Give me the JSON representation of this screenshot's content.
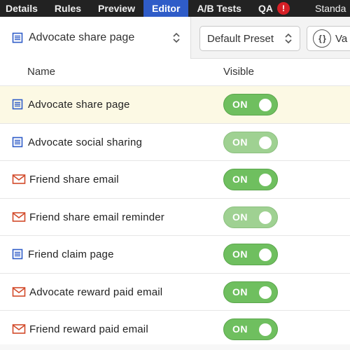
{
  "nav": {
    "tabs": [
      {
        "label": "Details"
      },
      {
        "label": "Rules"
      },
      {
        "label": "Preview"
      },
      {
        "label": "Editor"
      },
      {
        "label": "A/B Tests"
      },
      {
        "label": "QA"
      }
    ],
    "qa_badge": "!",
    "extra": "Standa"
  },
  "toolbar": {
    "page_select_value": "Advocate share page",
    "preset_value": "Default Preset",
    "variables_label": "Va",
    "braces": "{ }"
  },
  "table": {
    "headers": {
      "name": "Name",
      "visible": "Visible"
    },
    "rows": [
      {
        "name": "Advocate share page",
        "type": "page",
        "visible": "ON"
      },
      {
        "name": "Advocate social sharing",
        "type": "page",
        "visible": "ON"
      },
      {
        "name": "Friend share email",
        "type": "email",
        "visible": "ON"
      },
      {
        "name": "Friend share email reminder",
        "type": "email",
        "visible": "ON"
      },
      {
        "name": "Friend claim page",
        "type": "page",
        "visible": "ON"
      },
      {
        "name": "Advocate reward paid email",
        "type": "email",
        "visible": "ON"
      },
      {
        "name": "Friend reward paid email",
        "type": "email",
        "visible": "ON"
      }
    ]
  },
  "colors": {
    "nav_bg": "#222222",
    "active_tab": "#2f5cc8",
    "toggle_on": "#6fbf5f",
    "page_icon": "#2f5cc8",
    "email_icon": "#d24a2a",
    "selected_row": "#fcf9e4"
  }
}
